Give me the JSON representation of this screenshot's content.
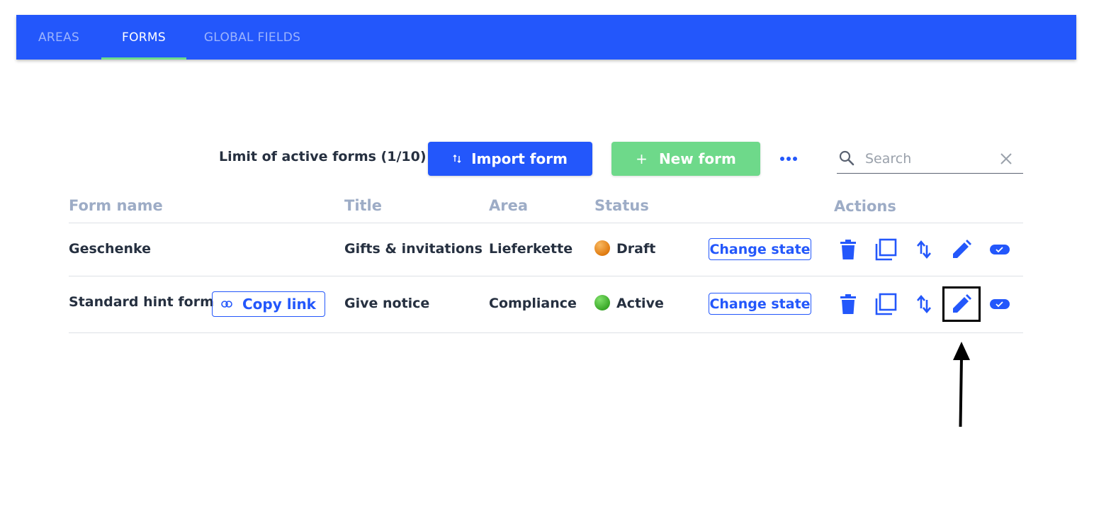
{
  "tabs": [
    {
      "label": "AREAS",
      "active": false
    },
    {
      "label": "FORMS",
      "active": true
    },
    {
      "label": "GLOBAL FIELDS",
      "active": false
    }
  ],
  "toolbar": {
    "limit_text": "Limit of active forms (1/10)",
    "import_label": "Import form",
    "new_label": "New form",
    "new_icon": "+",
    "search_placeholder": "Search"
  },
  "table": {
    "headers": [
      "Form name",
      "Title",
      "Area",
      "Status",
      "Actions"
    ],
    "rows": [
      {
        "form_name": "Geschenke",
        "title": "Gifts & invitations",
        "area": "Lieferkette",
        "status": "Draft",
        "change_state": "Change state"
      },
      {
        "form_name": "Standard hint form",
        "copy_link": "Copy link",
        "title": "Give notice",
        "area": "Compliance",
        "status": "Active",
        "change_state": "Change state"
      }
    ]
  },
  "colors": {
    "primary": "#2357fb",
    "success": "#6ed98a",
    "tab_indicator": "#6ddc8b",
    "header_text": "#9dacc6"
  }
}
